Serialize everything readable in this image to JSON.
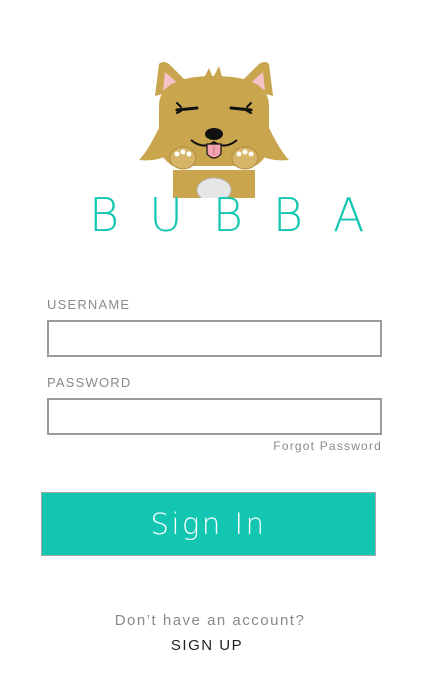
{
  "brand": {
    "name": "BUBBA",
    "accent_color": "#12c6b1",
    "mascot_icon": "dog-mascot-icon"
  },
  "form": {
    "username_label": "USERNAME",
    "username_value": "",
    "password_label": "PASSWORD",
    "password_value": "",
    "forgot_password_label": "Forgot Password",
    "sign_in_label": "Sign In"
  },
  "footer": {
    "no_account_text": "Don’t have an account?",
    "sign_up_label": "SIGN UP"
  }
}
